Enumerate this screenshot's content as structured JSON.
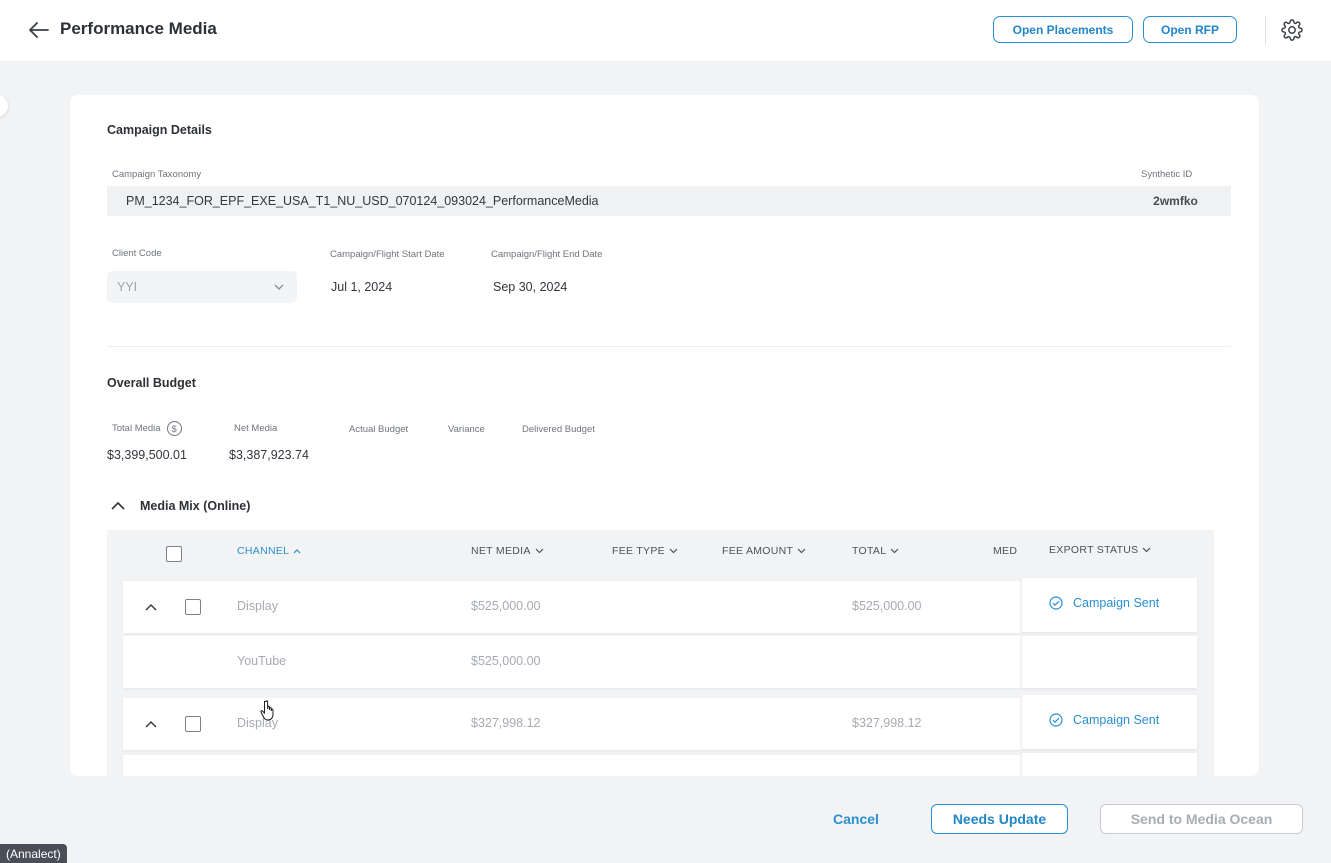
{
  "header": {
    "title": "Performance Media",
    "open_placements": "Open Placements",
    "open_rfp": "Open RFP"
  },
  "campaign_details": {
    "section_title": "Campaign Details",
    "taxonomy_label": "Campaign Taxonomy",
    "taxonomy_value": "PM_1234_FOR_EPF_EXE_USA_T1_NU_USD_070124_093024_PerformanceMedia",
    "synthetic_id_label": "Synthetic ID",
    "synthetic_id_value": "2wmfko",
    "client_code_label": "Client Code",
    "client_code_value": "YYI",
    "start_date_label": "Campaign/Flight Start Date",
    "start_date_value": "Jul 1, 2024",
    "end_date_label": "Campaign/Flight End Date",
    "end_date_value": "Sep 30, 2024"
  },
  "overall_budget": {
    "section_title": "Overall Budget",
    "total_media_label": "Total Media",
    "total_media_icon": "$",
    "total_media_value": "$3,399,500.01",
    "net_media_label": "Net Media",
    "net_media_value": "$3,387,923.74",
    "actual_budget_label": "Actual Budget",
    "variance_label": "Variance",
    "delivered_budget_label": "Delivered Budget"
  },
  "media_mix": {
    "title": "Media Mix (Online)",
    "columns": {
      "channel": "CHANNEL",
      "net_media": "NET MEDIA",
      "fee_type": "FEE TYPE",
      "fee_amount": "FEE AMOUNT",
      "total": "TOTAL",
      "med": "MED",
      "export_status": "EXPORT STATUS"
    },
    "rows": [
      {
        "channel": "Display",
        "net_media": "$525,000.00",
        "total": "$525,000.00",
        "export_status": "Campaign Sent"
      },
      {
        "channel": "YouTube",
        "net_media": "$525,000.00"
      },
      {
        "channel": "Display",
        "net_media": "$327,998.12",
        "total": "$327,998.12",
        "export_status": "Campaign Sent"
      }
    ]
  },
  "footer": {
    "cancel": "Cancel",
    "needs_update": "Needs Update",
    "send": "Send to Media Ocean"
  },
  "watermark": "(Annalect)",
  "colors": {
    "accent": "#2a8fd0",
    "background": "#f2f3f5"
  }
}
